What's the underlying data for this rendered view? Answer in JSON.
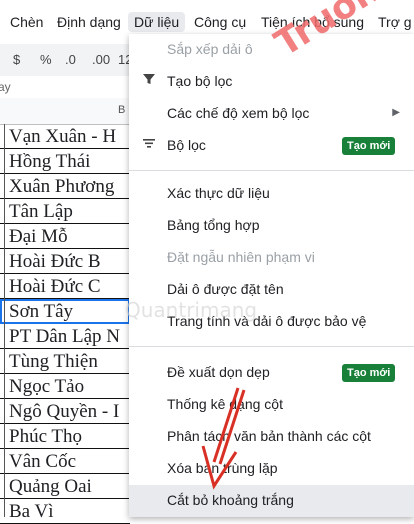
{
  "menubar": {
    "items": [
      {
        "label": "Chèn"
      },
      {
        "label": "Định dạng"
      },
      {
        "label": "Dữ liệu"
      },
      {
        "label": "Công cụ"
      },
      {
        "label": "Tiện ích bổ sung"
      },
      {
        "label": "Trợ g"
      }
    ]
  },
  "toolbar": {
    "dollar": "$",
    "percent": "%",
    "dec_less": ".0",
    "dec_more": ".00",
    "number": "12"
  },
  "formula_bar": {
    "fx": "ay"
  },
  "column_header": {
    "label": "B"
  },
  "sheet": {
    "cells": [
      "Vạn Xuân - H",
      "Hồng Thái",
      "Xuân Phương",
      "Tân Lập",
      "Đại Mỗ",
      "Hoài Đức B",
      "Hoài Đức C",
      "Sơn         Tây",
      "PT Dân Lập N",
      "Tùng Thiện",
      "Ngọc Tảo",
      "Ngô Quyền - I",
      "Phúc Thọ",
      "Vân Cốc",
      "Quảng Oai",
      "Ba Vì"
    ]
  },
  "data_menu": {
    "sort_range": "Sắp xếp dải ô",
    "create_filter": "Tạo bộ lọc",
    "filter_views": "Các chế độ xem bộ lọc",
    "slicer": "Bộ lọc",
    "new_badge_1": "Tạo mới",
    "data_validation": "Xác thực dữ liệu",
    "pivot_table": "Bảng tổng hợp",
    "randomize_range": "Đặt ngẫu nhiên phạm vi",
    "named_ranges": "Dải ô được đặt tên",
    "protected_sheets": "Trang tính và dải ô được bảo vệ",
    "cleanup_suggestions": "Đề xuất dọn dẹp",
    "new_badge_2": "Tạo mới",
    "column_stats": "Thống kê dạng cột",
    "split_text": "Phân tách văn bản thành các cột",
    "remove_duplicates": "Xóa bản trùng lặp",
    "trim_whitespace": "Cắt bỏ khoảng trắng"
  },
  "watermark": {
    "brand": "Truongtin.top",
    "faint": "Quantrimang"
  },
  "colors": {
    "watermark": "#f06a6a",
    "badge": "#188038",
    "arrow": "#d93025"
  }
}
